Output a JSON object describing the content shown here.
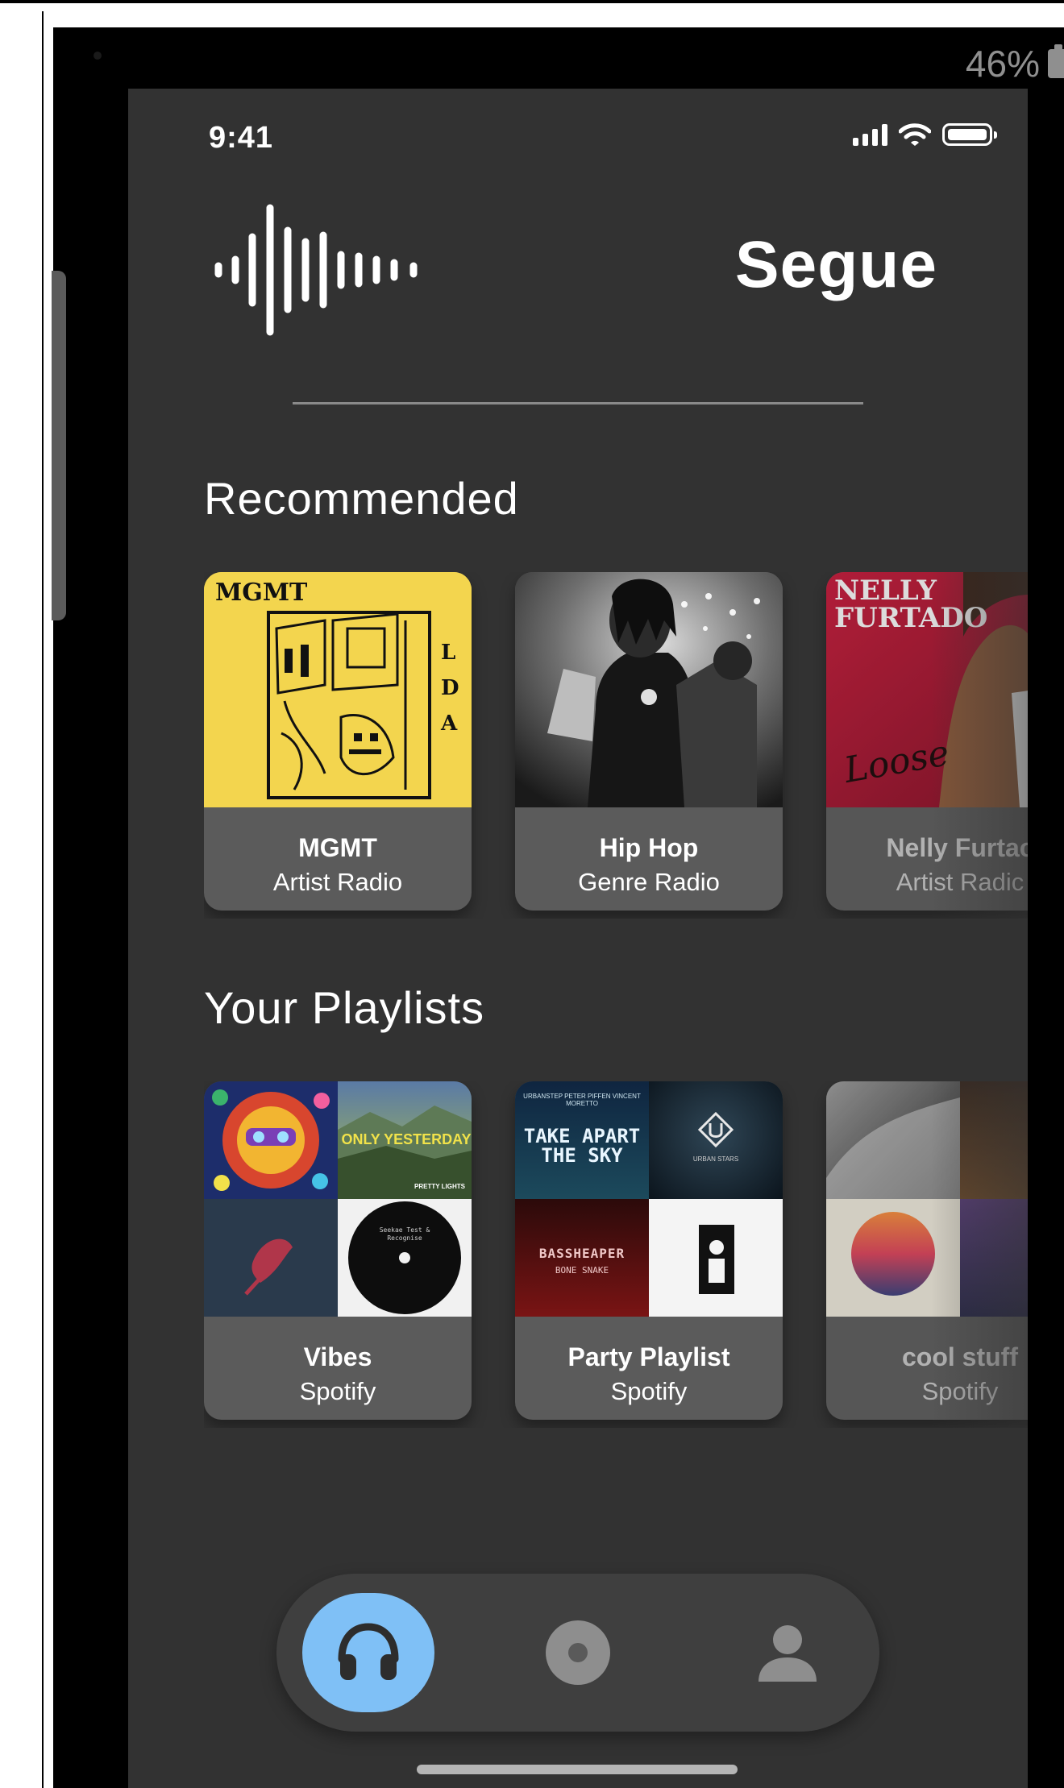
{
  "outer": {
    "battery_percent": "46%"
  },
  "status_bar": {
    "time": "9:41"
  },
  "brand": {
    "title": "Segue"
  },
  "recommended": {
    "title": "Recommended",
    "cards": [
      {
        "title": "MGMT",
        "subtitle": "Artist Radio",
        "art_text": "MGMT",
        "art_letters": "LDA"
      },
      {
        "title": "Hip Hop",
        "subtitle": "Genre Radio"
      },
      {
        "title": "Nelly Furtac",
        "subtitle": "Artist Radic",
        "art_text": "NELLY FURTADO",
        "art_script": "Loose"
      }
    ]
  },
  "playlists": {
    "title": "Your Playlists",
    "cards": [
      {
        "title": "Vibes",
        "subtitle": "Spotify",
        "tile_text": "ONLY YESTERDAY",
        "tile_small": "PRETTY LIGHTS",
        "record_text": "Seekae Test & Recognise"
      },
      {
        "title": "Party Playlist",
        "subtitle": "Spotify",
        "tile_text": "TAKE APART THE SKY",
        "tile_small": "BASSHEAPER",
        "tile_small_2": "BONE SNAKE",
        "tile_small_3": "URBAN STARS",
        "tile_small_4": "URBANSTEP PETER PIFFEN VINCENT MORETTO"
      },
      {
        "title": "cool stuff",
        "subtitle": "Spotify"
      }
    ]
  },
  "tab_bar": {
    "items": [
      {
        "icon": "headphones-icon",
        "active": true
      },
      {
        "icon": "disc-icon",
        "active": false
      },
      {
        "icon": "person-icon",
        "active": false
      }
    ],
    "active_color": "#7fc0f6"
  }
}
